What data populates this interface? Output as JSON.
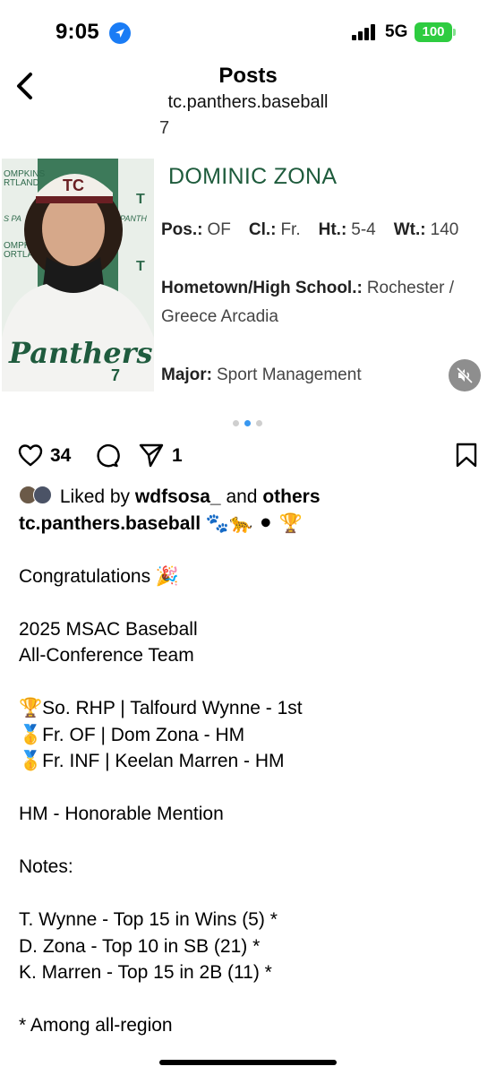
{
  "status_bar": {
    "time": "9:05",
    "network": "5G",
    "battery": "100",
    "battery_color": "#2ecc40",
    "location_color": "#1a7cf5"
  },
  "header": {
    "title": "Posts",
    "username": "tc.panthers.baseball",
    "back_icon": "chevron-left-icon"
  },
  "media": {
    "counter": "7",
    "player": {
      "name": "DOMINIC ZONA",
      "name_color": "#1e5b3c",
      "pos_label": "Pos.:",
      "pos": "OF",
      "cl_label": "Cl.:",
      "cl": "Fr.",
      "ht_label": "Ht.:",
      "ht": "5-4",
      "wt_label": "Wt.:",
      "wt": "140",
      "hometown_label": "Hometown/High School.:",
      "hometown_line1": "Rochester /",
      "hometown_line2": "Greece Arcadia",
      "major_label": "Major:",
      "major": "Sport Management"
    },
    "photo_lettering": {
      "backdrop_top": "OMPKINS",
      "backdrop_sub": "RTLAND",
      "backdrop_right": "OMPKINS",
      "backdrop_right_sub": "ORTLAND",
      "backdrop_panth": "PANTH",
      "backdrop_pa": "S PA",
      "cap_logo": "TC",
      "jersey": "Panthers",
      "jersey_number": "7"
    },
    "mute_icon": "speaker-muted-icon",
    "carousel_dots": 3,
    "active_dot": 1
  },
  "actions": {
    "likes": "34",
    "shares": "1",
    "icons": [
      "heart-icon",
      "comment-icon",
      "share-icon",
      "bookmark-icon"
    ]
  },
  "caption": {
    "liked_prefix": "Liked by",
    "liked_user": "wdfsosa_",
    "liked_and": "and",
    "liked_others": "others",
    "author": "tc.panthers.baseball",
    "author_emojis": "🐾🐆 ⚫ 🏆",
    "line_congrats": "Congratulations 🎉",
    "line_title1": "2025 MSAC Baseball",
    "line_title2": "All-Conference Team",
    "award1": "🏆So. RHP | Talfourd Wynne - 1st",
    "award2": "🥇Fr. OF | Dom Zona - HM",
    "award3": "🥇Fr. INF | Keelan Marren - HM",
    "hm_note": "HM - Honorable Mention",
    "notes_title": "Notes:",
    "note1": "T. Wynne - Top 15 in Wins (5) *",
    "note2": "D. Zona - Top 10 in SB (21) *",
    "note3": "K. Marren - Top 15 in 2B (11) *",
    "footnote": "* Among all-region"
  }
}
